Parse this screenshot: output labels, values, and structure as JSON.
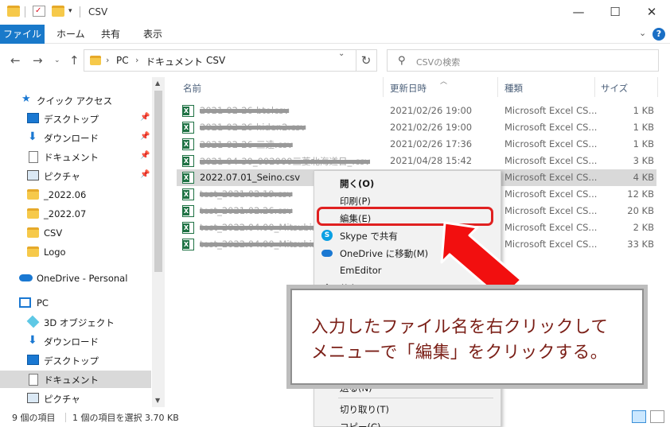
{
  "window": {
    "title": "CSV",
    "minimize": "—",
    "maximize": "☐",
    "close": "✕"
  },
  "ribbon": {
    "file": "ファイル",
    "tabs": [
      "ホーム",
      "共有",
      "表示"
    ],
    "expand": "⌄",
    "help": "?"
  },
  "address_bar": {
    "crumbs": [
      "PC",
      "ドキュメント",
      "CSV"
    ],
    "search_placeholder": "CSVの検索"
  },
  "sidebar": {
    "items": [
      {
        "label": "クイック アクセス",
        "icon": "star-icon"
      },
      {
        "label": "デスクトップ",
        "icon": "desktop-icon",
        "pinned": true
      },
      {
        "label": "ダウンロード",
        "icon": "download-icon",
        "pinned": true
      },
      {
        "label": "ドキュメント",
        "icon": "document-icon",
        "pinned": true
      },
      {
        "label": "ピクチャ",
        "icon": "pictures-icon",
        "pinned": true
      },
      {
        "label": "_2022.06",
        "icon": "folder-icon"
      },
      {
        "label": "_2022.07",
        "icon": "folder-icon"
      },
      {
        "label": "CSV",
        "icon": "folder-icon"
      },
      {
        "label": "Logo",
        "icon": "folder-icon"
      },
      {
        "label": "OneDrive - Personal",
        "icon": "onedrive-icon"
      },
      {
        "label": "PC",
        "icon": "pc-icon"
      },
      {
        "label": "3D オブジェクト",
        "icon": "3d-objects-icon"
      },
      {
        "label": "ダウンロード",
        "icon": "download-icon"
      },
      {
        "label": "デスクトップ",
        "icon": "desktop-icon"
      },
      {
        "label": "ドキュメント",
        "icon": "document-icon"
      },
      {
        "label": "ピクチャ",
        "icon": "pictures-icon"
      }
    ]
  },
  "columns": {
    "name": "名前",
    "modified": "更新日時",
    "type": "種類",
    "size": "サイズ"
  },
  "files": [
    {
      "name": "2021-02-26-btolcsv",
      "date": "2021/02/26 19:00",
      "type": "Microsoft Excel CS...",
      "size": "1 KB"
    },
    {
      "name": "2021-02-26-hiden2.csv",
      "date": "2021/02/26 19:00",
      "type": "Microsoft Excel CS...",
      "size": "1 KB"
    },
    {
      "name": "2021-02-26-三遠.csv",
      "date": "2021/02/26 17:36",
      "type": "Microsoft Excel CS...",
      "size": "1 KB"
    },
    {
      "name": "2021-04-30_002000三菱北海道日_.csv",
      "date": "2021/04/28 15:42",
      "type": "Microsoft Excel CS...",
      "size": "3 KB"
    },
    {
      "name": "2022.07.01_Seino.csv",
      "date": "",
      "type": "Microsoft Excel CS...",
      "size": "4 KB"
    },
    {
      "name": "test_2021.02.19.csv",
      "date": "",
      "type": "Microsoft Excel CS...",
      "size": "12 KB"
    },
    {
      "name": "test_2021.02.26.csv",
      "date": "",
      "type": "Microsoft Excel CS...",
      "size": "20 KB"
    },
    {
      "name": "test_2022.04.00_Mitsubishi",
      "date": "",
      "type": "Microsoft Excel CS...",
      "size": "2 KB"
    },
    {
      "name": "test_2022.04.00_Mitsubishi",
      "date": "",
      "type": "Microsoft Excel CS...",
      "size": "33 KB"
    }
  ],
  "context_menu": {
    "items": [
      {
        "label": "開く(O)",
        "bold": true
      },
      {
        "label": "印刷(P)"
      },
      {
        "label": "編集(E)"
      },
      {
        "label": "Skype で共有",
        "icon": "skype-icon"
      },
      {
        "label": "OneDrive に移動(M)",
        "icon": "onedrive-icon"
      },
      {
        "label": "EmEditor"
      },
      {
        "label": "共有",
        "icon": "share-icon"
      },
      {
        "label": "送る(N)",
        "submenu": true
      },
      {
        "label": "切り取り(T)"
      },
      {
        "label": "コピー(C)"
      }
    ]
  },
  "callout": {
    "line1": "入力したファイル名を右クリックして",
    "line2": "メニューで「編集」をクリックする。"
  },
  "status": {
    "count": "9 個の項目",
    "selection": "1 個の項目を選択  3.70 KB"
  },
  "colors": {
    "accent": "#1979ca",
    "highlight": "#e02020",
    "callout_text": "#7a1e16"
  }
}
